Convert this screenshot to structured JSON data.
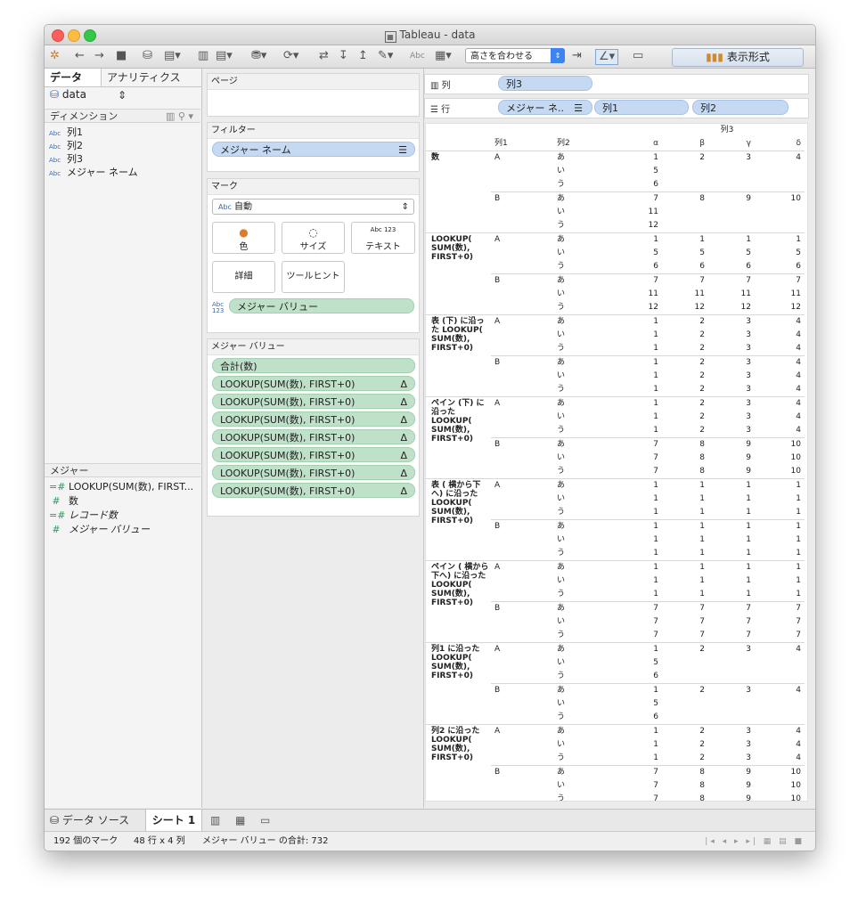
{
  "window": {
    "title": "Tableau - data"
  },
  "toolbar": {
    "fit_option": "高さを合わせる",
    "showme_label": "表示形式",
    "abc_label": "Abc"
  },
  "left_pane": {
    "tab_data": "データ",
    "tab_analytics": "アナリティクス",
    "datasource": "data",
    "dimensions_header": "ディメンション",
    "dimensions": [
      "列1",
      "列2",
      "列3",
      "メジャー ネーム"
    ],
    "measures_header": "メジャー",
    "measures": [
      "LOOKUP(SUM(数), FIRST...",
      "数",
      "レコード数",
      "メジャー バリュー"
    ],
    "abc_tag": "Abc"
  },
  "cards": {
    "pages_title": "ページ",
    "filters_title": "フィルター",
    "filter_pill": "メジャー ネーム",
    "marks_title": "マーク",
    "mark_type": "自動",
    "mark_color": "色",
    "mark_size": "サイズ",
    "mark_text": "テキスト",
    "mark_detail": "詳細",
    "mark_tooltip": "ツールヒント",
    "text_pill": "メジャー バリュー",
    "mv_title": "メジャー バリュー",
    "mv_first": "合計(数)",
    "mv_lookup": "LOOKUP(SUM(数), FIRST+0)",
    "delta": "Δ",
    "abc123": "Abc 123"
  },
  "shelves": {
    "columns_label": "列",
    "columns_pill": "列3",
    "rows_label": "行",
    "rows_pills": [
      "メジャー ネ..",
      "列1",
      "列2"
    ]
  },
  "viz": {
    "col3_header": "列3",
    "col1_header": "列1",
    "col2_header": "列2",
    "greek": [
      "α",
      "β",
      "γ",
      "δ"
    ],
    "groups": [
      {
        "name": "数",
        "rows": [
          [
            "A",
            "あ",
            "1",
            "2",
            "3",
            "4"
          ],
          [
            "",
            "い",
            "5",
            "",
            "",
            ""
          ],
          [
            "",
            "う",
            "6",
            "",
            "",
            ""
          ],
          [
            "B",
            "あ",
            "7",
            "8",
            "9",
            "10"
          ],
          [
            "",
            "い",
            "11",
            "",
            "",
            ""
          ],
          [
            "",
            "う",
            "12",
            "",
            "",
            ""
          ]
        ]
      },
      {
        "name": "LOOKUP( SUM(数), FIRST+0)",
        "rows": [
          [
            "A",
            "あ",
            "1",
            "1",
            "1",
            "1"
          ],
          [
            "",
            "い",
            "5",
            "5",
            "5",
            "5"
          ],
          [
            "",
            "う",
            "6",
            "6",
            "6",
            "6"
          ],
          [
            "B",
            "あ",
            "7",
            "7",
            "7",
            "7"
          ],
          [
            "",
            "い",
            "11",
            "11",
            "11",
            "11"
          ],
          [
            "",
            "う",
            "12",
            "12",
            "12",
            "12"
          ]
        ]
      },
      {
        "name": "表 (下) に沿った LOOKUP( SUM(数), FIRST+0)",
        "rows": [
          [
            "A",
            "あ",
            "1",
            "2",
            "3",
            "4"
          ],
          [
            "",
            "い",
            "1",
            "2",
            "3",
            "4"
          ],
          [
            "",
            "う",
            "1",
            "2",
            "3",
            "4"
          ],
          [
            "B",
            "あ",
            "1",
            "2",
            "3",
            "4"
          ],
          [
            "",
            "い",
            "1",
            "2",
            "3",
            "4"
          ],
          [
            "",
            "う",
            "1",
            "2",
            "3",
            "4"
          ]
        ]
      },
      {
        "name": "ペイン (下) に沿った LOOKUP( SUM(数), FIRST+0)",
        "rows": [
          [
            "A",
            "あ",
            "1",
            "2",
            "3",
            "4"
          ],
          [
            "",
            "い",
            "1",
            "2",
            "3",
            "4"
          ],
          [
            "",
            "う",
            "1",
            "2",
            "3",
            "4"
          ],
          [
            "B",
            "あ",
            "7",
            "8",
            "9",
            "10"
          ],
          [
            "",
            "い",
            "7",
            "8",
            "9",
            "10"
          ],
          [
            "",
            "う",
            "7",
            "8",
            "9",
            "10"
          ]
        ]
      },
      {
        "name": "表 ( 横から下へ) に沿った LOOKUP( SUM(数), FIRST+0)",
        "rows": [
          [
            "A",
            "あ",
            "1",
            "1",
            "1",
            "1"
          ],
          [
            "",
            "い",
            "1",
            "1",
            "1",
            "1"
          ],
          [
            "",
            "う",
            "1",
            "1",
            "1",
            "1"
          ],
          [
            "B",
            "あ",
            "1",
            "1",
            "1",
            "1"
          ],
          [
            "",
            "い",
            "1",
            "1",
            "1",
            "1"
          ],
          [
            "",
            "う",
            "1",
            "1",
            "1",
            "1"
          ]
        ]
      },
      {
        "name": "ペイン ( 横から下へ) に沿った LOOKUP( SUM(数), FIRST+0)",
        "rows": [
          [
            "A",
            "あ",
            "1",
            "1",
            "1",
            "1"
          ],
          [
            "",
            "い",
            "1",
            "1",
            "1",
            "1"
          ],
          [
            "",
            "う",
            "1",
            "1",
            "1",
            "1"
          ],
          [
            "B",
            "あ",
            "7",
            "7",
            "7",
            "7"
          ],
          [
            "",
            "い",
            "7",
            "7",
            "7",
            "7"
          ],
          [
            "",
            "う",
            "7",
            "7",
            "7",
            "7"
          ]
        ]
      },
      {
        "name": "列1 に沿った LOOKUP( SUM(数), FIRST+0)",
        "rows": [
          [
            "A",
            "あ",
            "1",
            "2",
            "3",
            "4"
          ],
          [
            "",
            "い",
            "5",
            "",
            "",
            ""
          ],
          [
            "",
            "う",
            "6",
            "",
            "",
            ""
          ],
          [
            "B",
            "あ",
            "1",
            "2",
            "3",
            "4"
          ],
          [
            "",
            "い",
            "5",
            "",
            "",
            ""
          ],
          [
            "",
            "う",
            "6",
            "",
            "",
            ""
          ]
        ]
      },
      {
        "name": "列2 に沿った LOOKUP( SUM(数), FIRST+0)",
        "rows": [
          [
            "A",
            "あ",
            "1",
            "2",
            "3",
            "4"
          ],
          [
            "",
            "い",
            "1",
            "2",
            "3",
            "4"
          ],
          [
            "",
            "う",
            "1",
            "2",
            "3",
            "4"
          ],
          [
            "B",
            "あ",
            "7",
            "8",
            "9",
            "10"
          ],
          [
            "",
            "い",
            "7",
            "8",
            "9",
            "10"
          ],
          [
            "",
            "う",
            "7",
            "8",
            "9",
            "10"
          ]
        ]
      }
    ]
  },
  "sheet_tabs": {
    "datasource": "データ ソース",
    "sheet1": "シート 1"
  },
  "status": {
    "marks": "192 個のマーク",
    "rows_cols": "48 行 x 4 列",
    "sum": "メジャー バリュー の合計: 732"
  }
}
